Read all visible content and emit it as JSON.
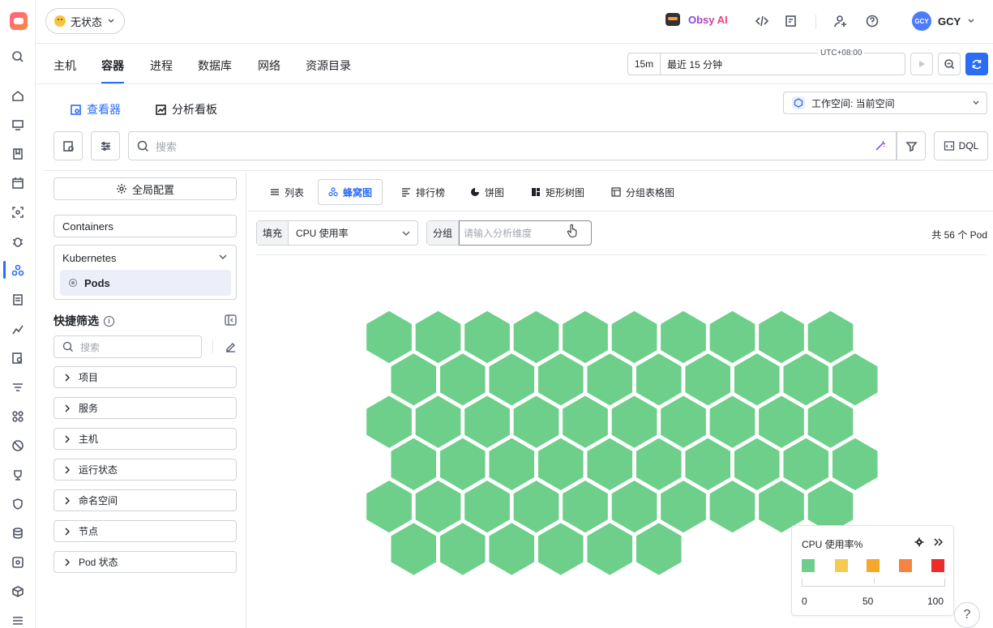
{
  "topbar": {
    "status_label": "无状态",
    "ai_label": "Obsy AI",
    "user_avatar": "GCY",
    "user_name": "GCY"
  },
  "nav": {
    "tabs": [
      "主机",
      "容器",
      "进程",
      "数据库",
      "网络",
      "资源目录"
    ],
    "active_tab": "容器",
    "time_short": "15m",
    "time_label": "最近 15 分钟",
    "timezone": "UTC+08:00"
  },
  "subheader": {
    "viewer_label": "查看器",
    "dashboard_label": "分析看板",
    "workspace_label": "工作空间: 当前空间"
  },
  "search": {
    "placeholder": "搜索",
    "dql_label": "DQL"
  },
  "sidebar": {
    "global_config": "全局配置",
    "containers_label": "Containers",
    "kubernetes_label": "Kubernetes",
    "pods_label": "Pods",
    "quick_filter_title": "快捷筛选",
    "quick_filter_placeholder": "搜索",
    "filters": [
      "项目",
      "服务",
      "主机",
      "运行状态",
      "命名空间",
      "节点",
      "Pod 状态"
    ]
  },
  "view": {
    "tabs": [
      "列表",
      "蜂窝图",
      "排行榜",
      "饼图",
      "矩形树图",
      "分组表格图"
    ],
    "active_tab": "蜂窝图",
    "fill_label": "填充",
    "fill_value": "CPU 使用率",
    "group_label": "分组",
    "group_placeholder": "请输入分析维度",
    "count_text": "共 56 个 Pod",
    "hex_count": 56,
    "hex_color": "#6ecf8a"
  },
  "legend": {
    "title": "CPU 使用率%",
    "colors": [
      "#6ecf8a",
      "#f5cb4f",
      "#f7a72a",
      "#f5843f",
      "#ee2a2a"
    ],
    "min": "0",
    "mid": "50",
    "max": "100"
  },
  "colors": {
    "accent": "#2a6cf6"
  }
}
